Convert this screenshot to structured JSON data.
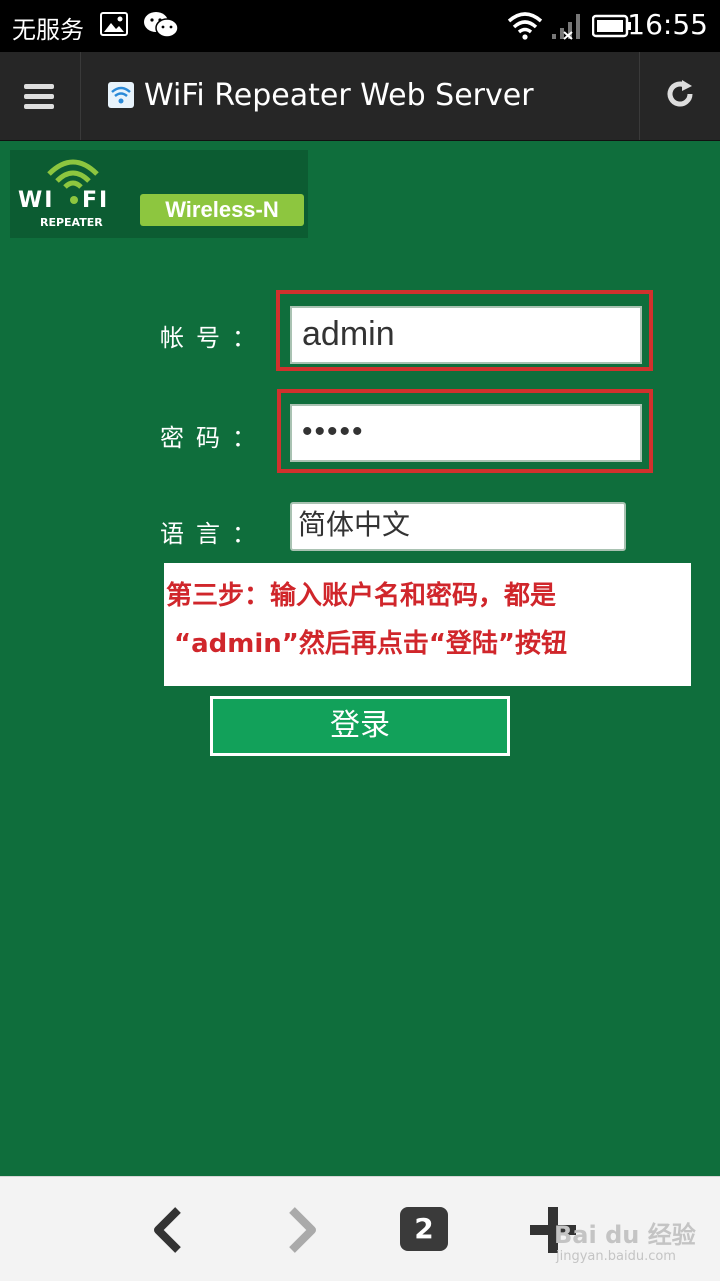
{
  "statusbar": {
    "carrier": "无服务",
    "time": "16:55",
    "icons": [
      "gallery-icon",
      "wechat-icon",
      "wifi-icon",
      "signal-icon",
      "battery-icon"
    ]
  },
  "browser": {
    "page_title": "WiFi Repeater Web Server",
    "tab_count": "2"
  },
  "logo": {
    "wi": "WI",
    "fi": "FI",
    "sub": "REPEATER",
    "badge": "Wireless-N"
  },
  "form": {
    "username_label": "帐号",
    "username_value": "admin",
    "password_label": "密码",
    "password_value": "•••••",
    "language_label": "语言",
    "language_value": "简体中文",
    "colon": "：",
    "login_label": "登录"
  },
  "annotation": {
    "line1": "第三步：输入账户名和密码，都是",
    "line2": "“admin”然后再点击“登陆”按钮"
  },
  "watermark": {
    "brand": "Bai du 经验",
    "url": "jingyan.baidu.com"
  },
  "colors": {
    "page_bg": "#0f6e3c",
    "highlight": "#d0312d",
    "button": "#12a15a",
    "badge": "#8dc63f"
  }
}
